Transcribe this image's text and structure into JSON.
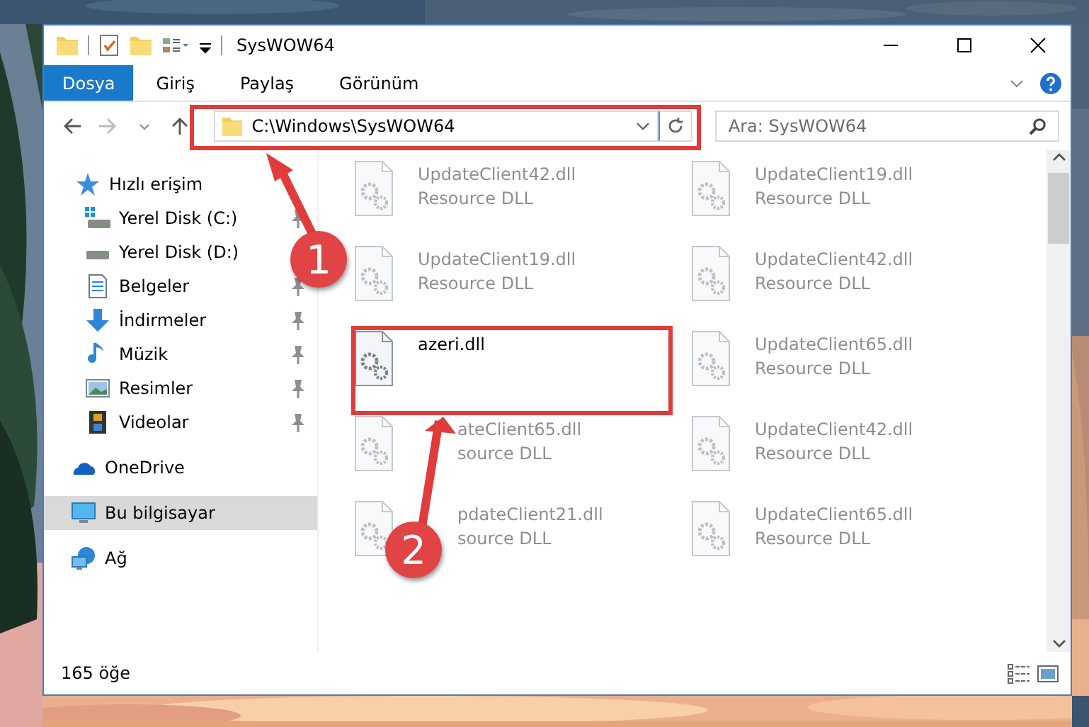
{
  "title_bar": {
    "title": "SysWOW64"
  },
  "ribbon_tabs": [
    {
      "label": "Dosya",
      "selected": true
    },
    {
      "label": "Giriş",
      "selected": false
    },
    {
      "label": "Paylaş",
      "selected": false
    },
    {
      "label": "Görünüm",
      "selected": false
    }
  ],
  "address_bar": {
    "path": "C:\\Windows\\SysWOW64"
  },
  "search": {
    "placeholder": "Ara: SysWOW64"
  },
  "sidebar": {
    "items": [
      {
        "label": "Hızlı erişim",
        "kind": "star",
        "selected": false,
        "pinned": false,
        "children": [
          {
            "label": "Yerel Disk (C:)",
            "kind": "system-drive",
            "selected": false,
            "pinned": true
          },
          {
            "label": "Yerel Disk (D:)",
            "kind": "drive",
            "selected": false,
            "pinned": false
          },
          {
            "label": "Belgeler",
            "kind": "documents",
            "selected": false,
            "pinned": true
          },
          {
            "label": "İndirmeler",
            "kind": "download",
            "selected": false,
            "pinned": true
          },
          {
            "label": "Müzik",
            "kind": "music",
            "selected": false,
            "pinned": true
          },
          {
            "label": "Resimler",
            "kind": "pictures",
            "selected": false,
            "pinned": true
          },
          {
            "label": "Videolar",
            "kind": "videos",
            "selected": false,
            "pinned": true
          }
        ]
      },
      {
        "label": "OneDrive",
        "kind": "cloud",
        "selected": false,
        "pinned": false
      },
      {
        "label": "Bu bilgisayar",
        "kind": "computer",
        "selected": true,
        "pinned": false
      },
      {
        "label": "Ağ",
        "kind": "network",
        "selected": false,
        "pinned": false
      }
    ]
  },
  "files": [
    {
      "name": "UpdateClient42.dll",
      "type": "Resource DLL",
      "faded": true,
      "covered": false
    },
    {
      "name": "UpdateClient19.dll",
      "type": "Resource DLL",
      "faded": true,
      "covered": false
    },
    {
      "name": "UpdateClient19.dll",
      "type": "Resource DLL",
      "faded": true,
      "covered": false
    },
    {
      "name": "UpdateClient42.dll",
      "type": "Resource DLL",
      "faded": true,
      "covered": false
    },
    {
      "name": "azeri.dll",
      "faded": false,
      "covered": false
    },
    {
      "name": "UpdateClient65.dll",
      "type": "Resource DLL",
      "faded": true,
      "covered": false
    },
    {
      "name": "ateClient65.dll",
      "type": "source DLL",
      "faded": true,
      "covered": true
    },
    {
      "name": "UpdateClient42.dll",
      "type": "Resource DLL",
      "faded": true,
      "covered": false
    },
    {
      "name": "pdateClient21.dll",
      "type": "source DLL",
      "faded": true,
      "covered": true
    },
    {
      "name": "UpdateClient65.dll",
      "type": "Resource DLL",
      "faded": true,
      "covered": false
    }
  ],
  "status_bar": {
    "item_count": "165 öğe"
  },
  "annotations": [
    {
      "label": "1"
    },
    {
      "label": "2"
    }
  ]
}
